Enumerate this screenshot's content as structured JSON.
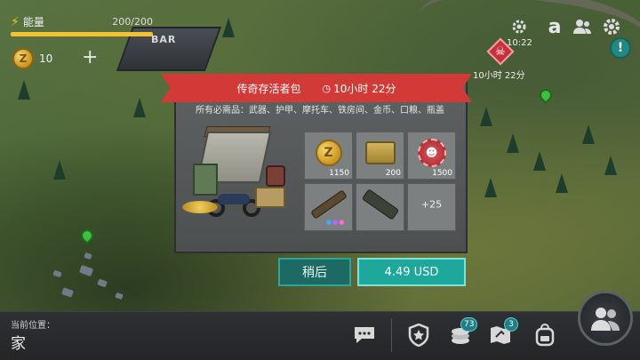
{
  "hud": {
    "energy_label": "能量",
    "energy_value": "200/200",
    "energy_fraction": 1.0,
    "coin_symbol": "Z",
    "coin_value": "10",
    "coin_add": "+"
  },
  "top_right": {
    "clock_text": "10:22",
    "brand_letter": "a",
    "info_label": "!"
  },
  "map": {
    "bar_sign": "BAR",
    "danger_timer": "10小时 22分"
  },
  "offer": {
    "title": "传奇存活者包",
    "timer": "10小时 22分",
    "description": "所有必需品：武器、护甲、摩托车、铁房间、金币、口粮、瓶盖",
    "items": [
      {
        "name": "gold-coins",
        "symbol": "Z",
        "quantity": "1150"
      },
      {
        "name": "rations",
        "quantity": "200"
      },
      {
        "name": "bottle-caps",
        "quantity": "1500"
      },
      {
        "name": "rifle",
        "quantity": ""
      },
      {
        "name": "machine-gun",
        "quantity": ""
      },
      {
        "name": "more",
        "label": "+25"
      }
    ],
    "later_button": "稍后",
    "buy_button": "4.49 USD"
  },
  "bottom_bar": {
    "location_label": "当前位置：",
    "location_value": "家",
    "resources_badge": "73",
    "map_badge": "3"
  },
  "colors": {
    "ribbon": "#d23a38",
    "buy_button": "#1ea79b",
    "later_button": "#1d6a64",
    "energy": "#f2c230"
  }
}
